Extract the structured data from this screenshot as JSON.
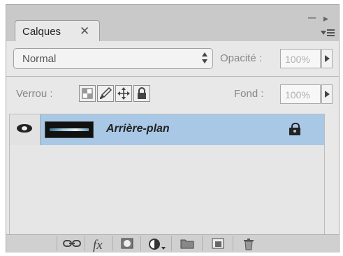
{
  "panel": {
    "tab_label": "Calques",
    "tab_close_glyph": "✕",
    "minimize_glyph": "–",
    "collapse_glyph": "▸",
    "blend_mode": "Normal",
    "opacity_label": "Opacité :",
    "opacity_value": "100%",
    "lock_label": "Verrou :",
    "fill_label": "Fond :",
    "fill_value": "100%",
    "layers": [
      {
        "name": "Arrière-plan",
        "visible": true,
        "locked": true,
        "selected": true
      }
    ],
    "icons": {
      "lock_transparency": "checkerboard-lock-icon",
      "lock_image": "brush-lock-icon",
      "lock_position": "move-lock-icon",
      "lock_all": "padlock-icon",
      "link": "link-icon",
      "fx": "fx",
      "mask": "mask-icon",
      "adjustment": "adjustment-layer-icon",
      "group": "folder-icon",
      "new_layer": "new-layer-icon",
      "delete": "trash-icon"
    },
    "colors": {
      "selection": "#a9c8e6",
      "panel_bg": "#e8e8e8"
    }
  }
}
